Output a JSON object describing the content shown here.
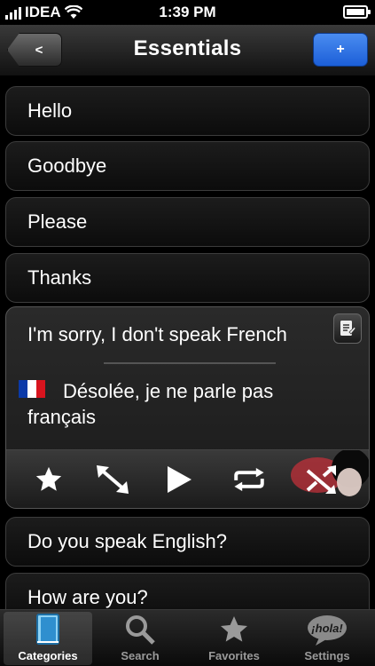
{
  "status_bar": {
    "carrier": "IDEA",
    "time": "1:39 PM"
  },
  "nav": {
    "back_label": "<",
    "title": "Essentials",
    "add_label": "+"
  },
  "phrases": [
    {
      "text": "Hello"
    },
    {
      "text": "Goodbye"
    },
    {
      "text": "Please"
    },
    {
      "text": "Thanks"
    }
  ],
  "expanded": {
    "english": "I'm sorry, I don't speak French",
    "translation": "Désolée, je ne parle pas français",
    "flag_colors": [
      "#0b3aa8",
      "#ffffff",
      "#d8141e"
    ],
    "controls": [
      "star-icon",
      "expand-arrows-icon",
      "play-icon",
      "repeat-icon",
      "shuffle-icon"
    ]
  },
  "phrases_after": [
    {
      "text": "Do you speak English?"
    },
    {
      "text": "How are you?"
    }
  ],
  "tabs": [
    {
      "label": "Categories",
      "icon": "book-icon",
      "active": true
    },
    {
      "label": "Search",
      "icon": "magnifier-icon",
      "active": false
    },
    {
      "label": "Favorites",
      "icon": "star-icon",
      "active": false
    },
    {
      "label": "Settings",
      "icon": "hola-bubble-icon",
      "active": false
    }
  ],
  "accent_color": "#1c5fd8"
}
